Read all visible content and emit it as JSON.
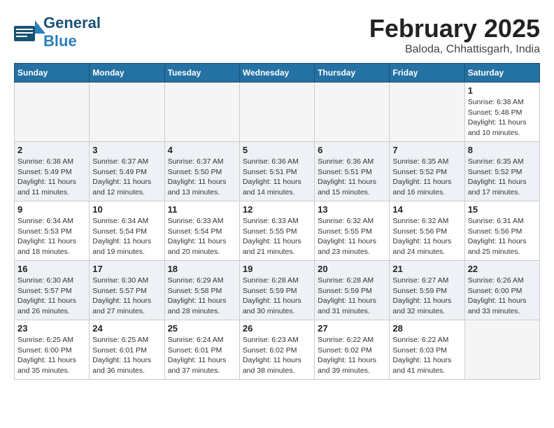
{
  "logo": {
    "general": "General",
    "blue": "Blue"
  },
  "title": "February 2025",
  "location": "Baloda, Chhattisgarh, India",
  "days_of_week": [
    "Sunday",
    "Monday",
    "Tuesday",
    "Wednesday",
    "Thursday",
    "Friday",
    "Saturday"
  ],
  "weeks": [
    [
      {
        "day": "",
        "info": ""
      },
      {
        "day": "",
        "info": ""
      },
      {
        "day": "",
        "info": ""
      },
      {
        "day": "",
        "info": ""
      },
      {
        "day": "",
        "info": ""
      },
      {
        "day": "",
        "info": ""
      },
      {
        "day": "1",
        "info": "Sunrise: 6:38 AM\nSunset: 5:48 PM\nDaylight: 11 hours\nand 10 minutes."
      }
    ],
    [
      {
        "day": "2",
        "info": "Sunrise: 6:38 AM\nSunset: 5:49 PM\nDaylight: 11 hours\nand 11 minutes."
      },
      {
        "day": "3",
        "info": "Sunrise: 6:37 AM\nSunset: 5:49 PM\nDaylight: 11 hours\nand 12 minutes."
      },
      {
        "day": "4",
        "info": "Sunrise: 6:37 AM\nSunset: 5:50 PM\nDaylight: 11 hours\nand 13 minutes."
      },
      {
        "day": "5",
        "info": "Sunrise: 6:36 AM\nSunset: 5:51 PM\nDaylight: 11 hours\nand 14 minutes."
      },
      {
        "day": "6",
        "info": "Sunrise: 6:36 AM\nSunset: 5:51 PM\nDaylight: 11 hours\nand 15 minutes."
      },
      {
        "day": "7",
        "info": "Sunrise: 6:35 AM\nSunset: 5:52 PM\nDaylight: 11 hours\nand 16 minutes."
      },
      {
        "day": "8",
        "info": "Sunrise: 6:35 AM\nSunset: 5:52 PM\nDaylight: 11 hours\nand 17 minutes."
      }
    ],
    [
      {
        "day": "9",
        "info": "Sunrise: 6:34 AM\nSunset: 5:53 PM\nDaylight: 11 hours\nand 18 minutes."
      },
      {
        "day": "10",
        "info": "Sunrise: 6:34 AM\nSunset: 5:54 PM\nDaylight: 11 hours\nand 19 minutes."
      },
      {
        "day": "11",
        "info": "Sunrise: 6:33 AM\nSunset: 5:54 PM\nDaylight: 11 hours\nand 20 minutes."
      },
      {
        "day": "12",
        "info": "Sunrise: 6:33 AM\nSunset: 5:55 PM\nDaylight: 11 hours\nand 21 minutes."
      },
      {
        "day": "13",
        "info": "Sunrise: 6:32 AM\nSunset: 5:55 PM\nDaylight: 11 hours\nand 23 minutes."
      },
      {
        "day": "14",
        "info": "Sunrise: 6:32 AM\nSunset: 5:56 PM\nDaylight: 11 hours\nand 24 minutes."
      },
      {
        "day": "15",
        "info": "Sunrise: 6:31 AM\nSunset: 5:56 PM\nDaylight: 11 hours\nand 25 minutes."
      }
    ],
    [
      {
        "day": "16",
        "info": "Sunrise: 6:30 AM\nSunset: 5:57 PM\nDaylight: 11 hours\nand 26 minutes."
      },
      {
        "day": "17",
        "info": "Sunrise: 6:30 AM\nSunset: 5:57 PM\nDaylight: 11 hours\nand 27 minutes."
      },
      {
        "day": "18",
        "info": "Sunrise: 6:29 AM\nSunset: 5:58 PM\nDaylight: 11 hours\nand 28 minutes."
      },
      {
        "day": "19",
        "info": "Sunrise: 6:28 AM\nSunset: 5:59 PM\nDaylight: 11 hours\nand 30 minutes."
      },
      {
        "day": "20",
        "info": "Sunrise: 6:28 AM\nSunset: 5:59 PM\nDaylight: 11 hours\nand 31 minutes."
      },
      {
        "day": "21",
        "info": "Sunrise: 6:27 AM\nSunset: 5:59 PM\nDaylight: 11 hours\nand 32 minutes."
      },
      {
        "day": "22",
        "info": "Sunrise: 6:26 AM\nSunset: 6:00 PM\nDaylight: 11 hours\nand 33 minutes."
      }
    ],
    [
      {
        "day": "23",
        "info": "Sunrise: 6:25 AM\nSunset: 6:00 PM\nDaylight: 11 hours\nand 35 minutes."
      },
      {
        "day": "24",
        "info": "Sunrise: 6:25 AM\nSunset: 6:01 PM\nDaylight: 11 hours\nand 36 minutes."
      },
      {
        "day": "25",
        "info": "Sunrise: 6:24 AM\nSunset: 6:01 PM\nDaylight: 11 hours\nand 37 minutes."
      },
      {
        "day": "26",
        "info": "Sunrise: 6:23 AM\nSunset: 6:02 PM\nDaylight: 11 hours\nand 38 minutes."
      },
      {
        "day": "27",
        "info": "Sunrise: 6:22 AM\nSunset: 6:02 PM\nDaylight: 11 hours\nand 39 minutes."
      },
      {
        "day": "28",
        "info": "Sunrise: 6:22 AM\nSunset: 6:03 PM\nDaylight: 11 hours\nand 41 minutes."
      },
      {
        "day": "",
        "info": ""
      }
    ]
  ]
}
